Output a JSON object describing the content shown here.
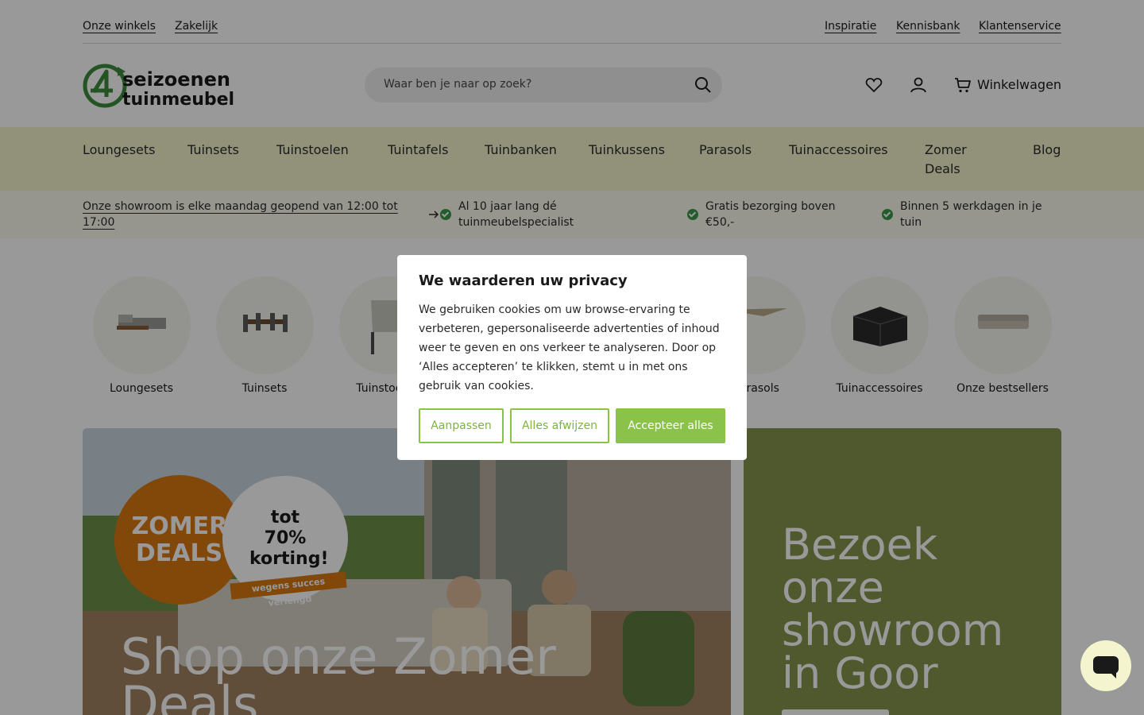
{
  "utility": {
    "left_links": [
      "Onze winkels",
      "Zakelijk"
    ],
    "right_links": [
      "Inspiratie",
      "Kennisbank",
      "Klantenservice"
    ]
  },
  "header": {
    "logo_text": "4seizoenen tuinmeubelen",
    "search_placeholder": "Waar ben je naar op zoek?",
    "cart_label": "Winkelwagen",
    "icons": [
      "heart-icon",
      "user-icon",
      "cart-icon",
      "search-icon"
    ]
  },
  "nav": {
    "items": [
      "Loungesets",
      "Tuinsets",
      "Tuinstoelen",
      "Tuintafels",
      "Tuinbanken",
      "Tuinkussens",
      "Parasols",
      "Tuinaccessoires",
      "Zomer Deals",
      "Blog"
    ]
  },
  "usp": {
    "showroom_link": "Onze showroom is elke maandag geopend van 12:00 tot 17:00",
    "items": [
      "Al 10 jaar lang dé tuinmeubelspecialist",
      "Gratis bezorging boven €50,-",
      "Binnen 5 werkdagen in je tuin"
    ]
  },
  "categories": [
    "Loungesets",
    "Tuinsets",
    "Tuinstoelen",
    "Parasols",
    "Tuinaccessoires",
    "Onze bestsellers"
  ],
  "hero": {
    "title": "Shop onze Zomer Deals",
    "badge_left": "ZOMER DEALS",
    "badge_right": "tot 70% korting!",
    "ribbon": "wegens succes verlengd"
  },
  "showroom": {
    "title": "Bezoek onze showroom in Goor"
  },
  "cookie": {
    "title": "We waarderen uw privacy",
    "body": "We gebruiken cookies om uw browse-ervaring te verbeteren, gepersonaliseerde advertenties of inhoud weer te geven en ons verkeer te analyseren. Door op ‘Alles accepteren’ te klikken, stemt u in met ons gebruik van cookies.",
    "customize": "Aanpassen",
    "reject": "Alles afwijzen",
    "accept": "Accepteer alles",
    "accent": "#8bc34a"
  },
  "colors": {
    "nav_bg": "#f4f4ce",
    "usp_bg": "#fbfbee",
    "showroom_bg": "#86944e",
    "badge_orange": "#d9780f"
  }
}
